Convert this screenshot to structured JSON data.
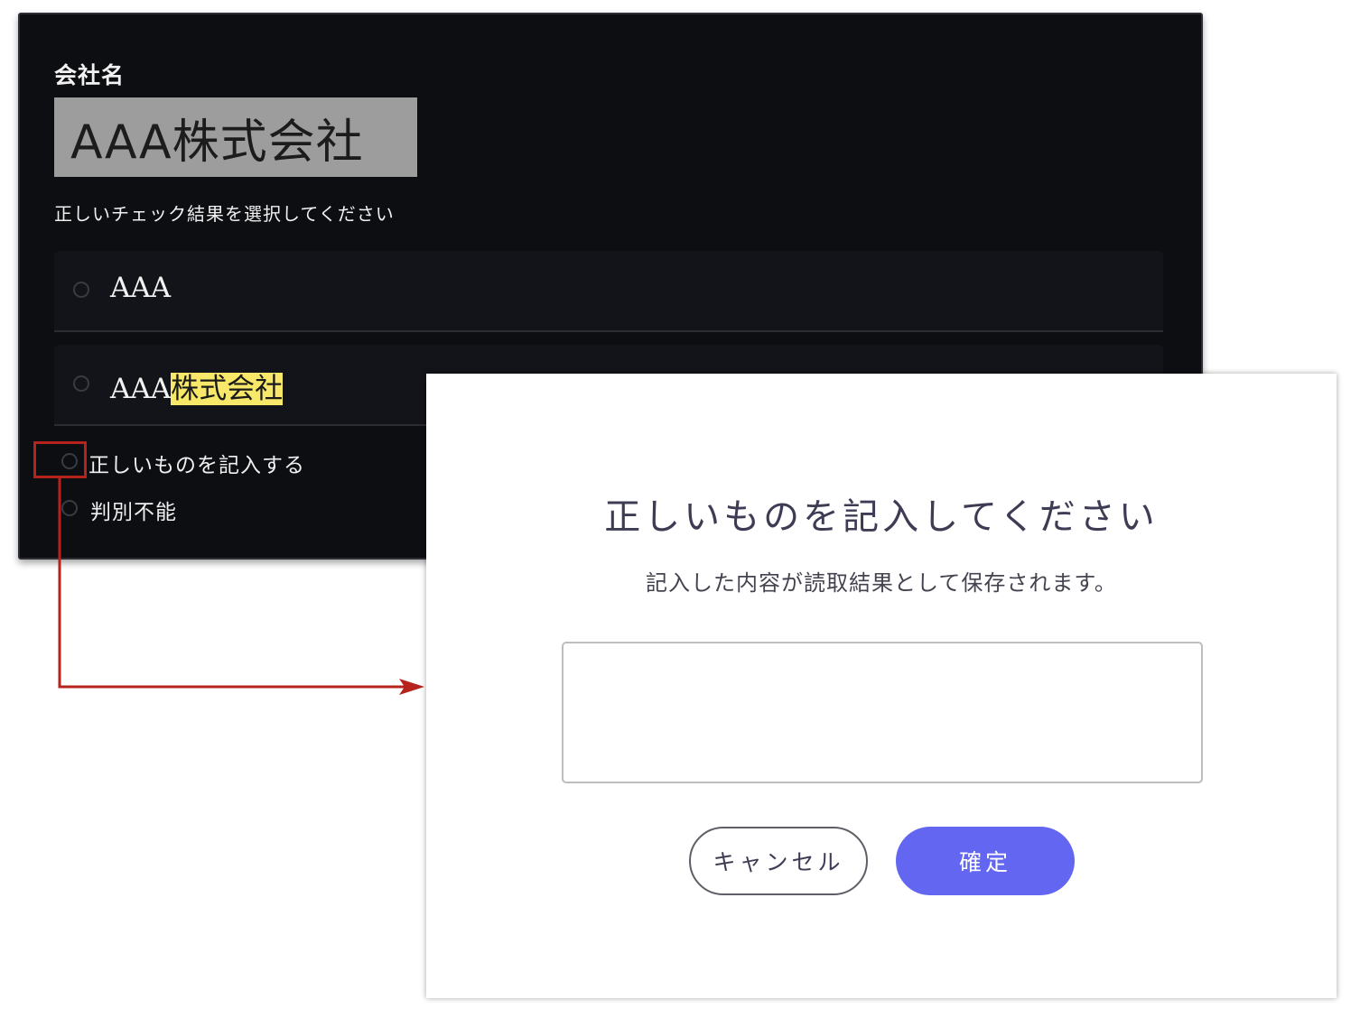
{
  "form": {
    "field_label": "会社名",
    "ocr_image_text": "AAA株式会社",
    "instruction": "正しいチェック結果を選択してください",
    "options": [
      {
        "prefix": "AAA",
        "highlighted": ""
      },
      {
        "prefix": "AAA",
        "highlighted": "株式会社"
      }
    ],
    "manual_entry_label": "正しいものを記入する",
    "undeterminable_label": "判別不能"
  },
  "modal": {
    "title": "正しいものを記入してください",
    "description": "記入した内容が読取結果として保存されます。",
    "input_value": "",
    "cancel_label": "キャンセル",
    "confirm_label": "確定"
  },
  "colors": {
    "dark_bg": "#0d0e12",
    "highlight": "#f8e86a",
    "annotation_red": "#b5231c",
    "confirm_button": "#6366f1"
  }
}
